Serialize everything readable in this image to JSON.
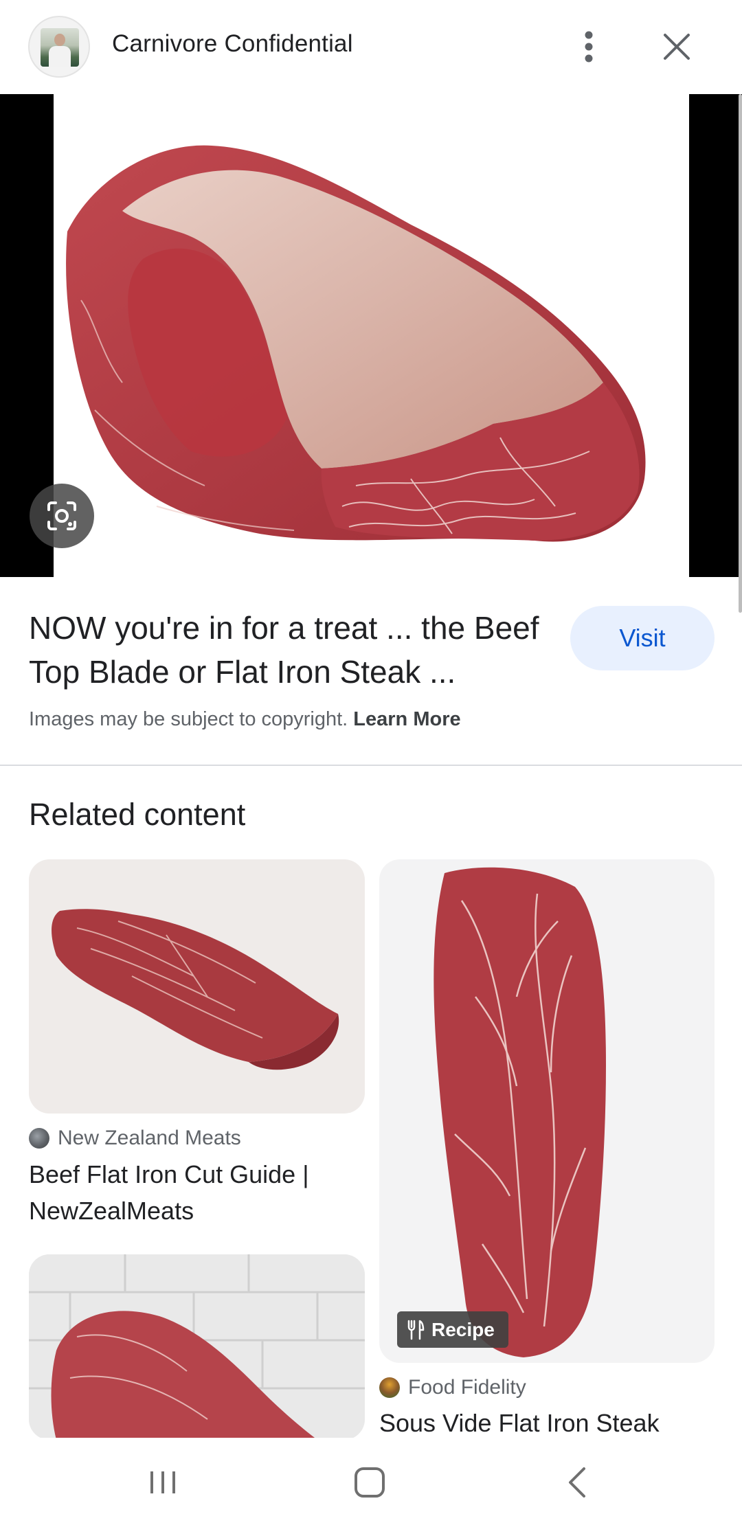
{
  "header": {
    "site_title": "Carnivore Confidential",
    "avatar": "site-avatar-icon",
    "more_icon": "more-vert-icon",
    "close_icon": "close-icon"
  },
  "hero": {
    "lens_icon": "lens-icon"
  },
  "result": {
    "title": "NOW you're in for a treat ... the Beef Top Blade or Flat Iron Steak ...",
    "visit_label": "Visit",
    "copyright_text": "Images may be subject to copyright.",
    "learn_more": "Learn More"
  },
  "related": {
    "heading": "Related content",
    "items": [
      {
        "source": "New Zealand Meats",
        "title": "Beef Flat Iron Cut Guide | NewZealMeats"
      },
      {
        "source": "Food Fidelity",
        "title": "Sous Vide Flat Iron Steak",
        "badge": "Recipe"
      },
      {
        "source": "",
        "title": ""
      }
    ]
  },
  "navbar": {
    "recents_icon": "recents-icon",
    "home_icon": "home-icon",
    "back_icon": "back-icon"
  },
  "colors": {
    "accent": "#0b57d0",
    "visit_bg": "#e8f0fe",
    "text": "#202124",
    "muted": "#5f6368"
  }
}
